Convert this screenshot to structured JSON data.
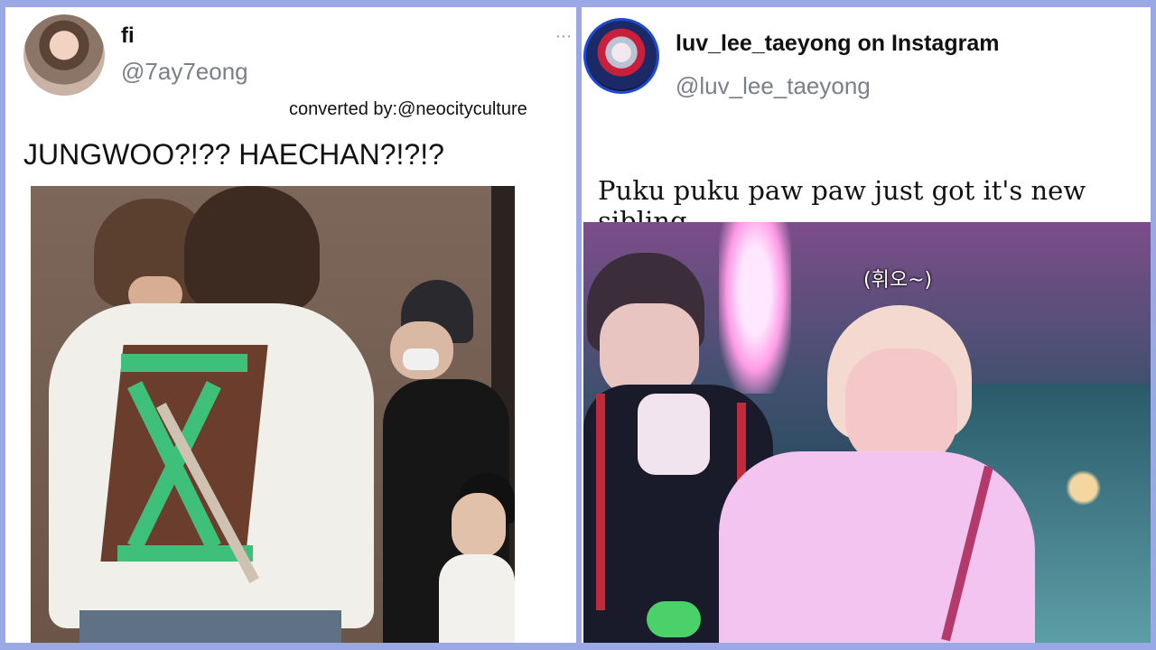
{
  "left_post": {
    "display_name": "fi",
    "handle": "@7ay7eong",
    "more_glyph": "⋯",
    "credit": "converted by:@neocityculture",
    "text": "JUNGWOO?!?? HAECHAN?!?!?"
  },
  "right_post": {
    "display_name": "luv_lee_taeyong on Instagram",
    "handle": "@luv_lee_taeyong",
    "text": "Puku puku paw paw just got it's new sibling",
    "video_caption": "(휘오~)"
  },
  "colors": {
    "background": "#9aa9e6",
    "card": "#ffffff",
    "handle_gray": "#7a7f88",
    "instagram_ring": "#1f4bd1"
  }
}
